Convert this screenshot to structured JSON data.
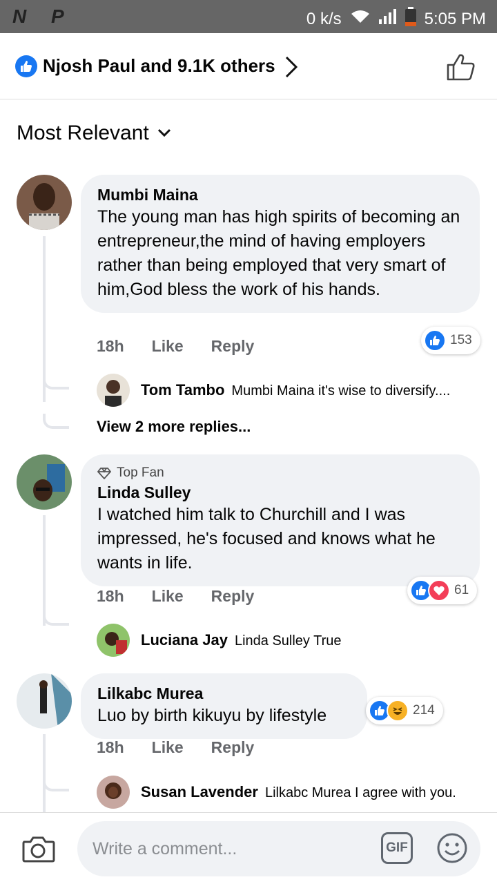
{
  "status_bar": {
    "left_icons": "N P",
    "net_speed": "0 k/s",
    "time": "5:05 PM"
  },
  "header": {
    "likes_text": "Njosh Paul and 9.1K others"
  },
  "sort": {
    "label": "Most Relevant"
  },
  "comments": [
    {
      "author": "Mumbi Maina",
      "text": "The young man has high spirits of becoming an entrepreneur,the mind of having employers rather than being employed that very smart of  him,God bless the work of his hands.",
      "time": "18h",
      "like_label": "Like",
      "reply_label": "Reply",
      "reactions": [
        "like"
      ],
      "reaction_count": "153",
      "reply": {
        "author": "Tom Tambo",
        "text": "Mumbi Maina it's wise to diversify...."
      },
      "view_more": "View 2 more replies..."
    },
    {
      "badge": "Top Fan",
      "author": "Linda Sulley",
      "text": "I watched him talk to Churchill and I was impressed, he's focused and knows what he wants in life.",
      "time": "18h",
      "like_label": "Like",
      "reply_label": "Reply",
      "reactions": [
        "like",
        "love"
      ],
      "reaction_count": "61",
      "reply": {
        "author": "Luciana Jay",
        "text": "Linda Sulley True"
      }
    },
    {
      "author": "Lilkabc Murea",
      "text": "Luo by birth kikuyu by lifestyle",
      "time": "18h",
      "like_label": "Like",
      "reply_label": "Reply",
      "reactions": [
        "like",
        "haha"
      ],
      "reaction_count": "214",
      "reply": {
        "author": "Susan Lavender",
        "text": "Lilkabc Murea I agree with you."
      }
    }
  ],
  "composer": {
    "placeholder": "Write a comment...",
    "gif_label": "GIF"
  },
  "colors": {
    "like_blue": "#1877f2",
    "love_red": "#f33e58",
    "haha_yellow": "#f7b125"
  }
}
